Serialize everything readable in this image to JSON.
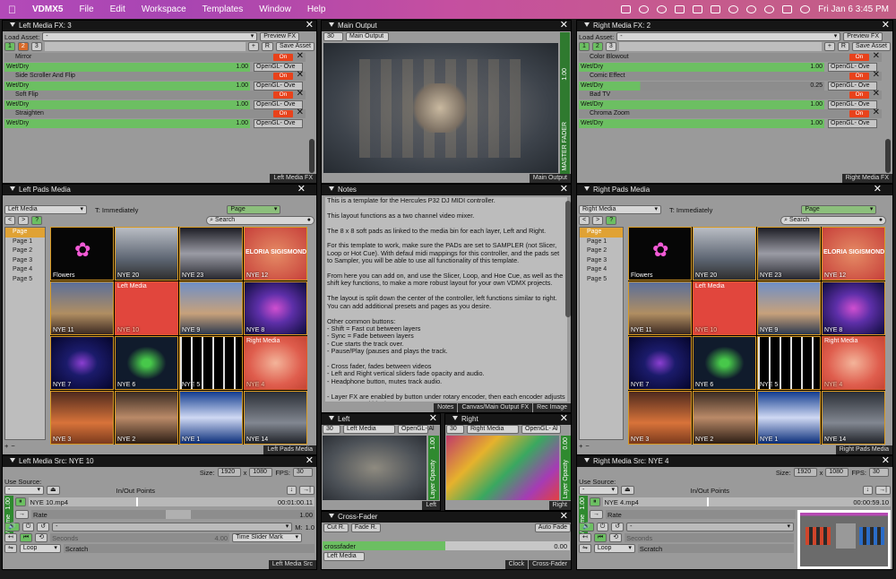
{
  "menubar": {
    "app": "VDMX5",
    "items": [
      "File",
      "Edit",
      "Workspace",
      "Templates",
      "Window",
      "Help"
    ],
    "clock": "Fri Jan 6  3:45 PM"
  },
  "left_fx": {
    "title": "Left Media FX: 3",
    "load_asset": "Load Asset:",
    "preview": "Preview FX",
    "tabs": [
      "1",
      "2",
      "3"
    ],
    "plus": "+",
    "r": "R",
    "save": "Save Asset",
    "effects": [
      {
        "name": "Mirror",
        "on": "On",
        "wd": "Wet/Dry",
        "val": "1.00",
        "gl": "OpenGL- Ove"
      },
      {
        "name": "Side Scroller And Flip",
        "on": "On",
        "wd": "Wet/Dry",
        "val": "1.00",
        "gl": "OpenGL- Ove"
      },
      {
        "name": "Soft Flip",
        "on": "On",
        "wd": "Wet/Dry",
        "val": "1.00",
        "gl": "OpenGL- Ove"
      },
      {
        "name": "Straighten",
        "on": "On",
        "wd": "Wet/Dry",
        "val": "1.00",
        "gl": "OpenGL- Ove"
      }
    ],
    "footer": "Left Media FX"
  },
  "main_output": {
    "title": "Main Output",
    "fps": "30",
    "sel": "Main Output",
    "fader": "MASTER FADER",
    "fader_val": "1.00",
    "footer": "Main Output"
  },
  "right_fx": {
    "title": "Right Media FX: 2",
    "load_asset": "Load Asset:",
    "preview": "Preview FX",
    "tabs": [
      "1",
      "2",
      "3"
    ],
    "plus": "+",
    "r": "R",
    "save": "Save Asset",
    "effects": [
      {
        "name": "Color Blowout",
        "on": "On",
        "wd": "Wet/Dry",
        "val": "1.00",
        "gl": "OpenGL- Ove"
      },
      {
        "name": "Comic Effect",
        "on": "On",
        "wd": "Wet/Dry",
        "val": "0.25",
        "gl": "OpenGL- Ove"
      },
      {
        "name": "Bad TV",
        "on": "On",
        "wd": "Wet/Dry",
        "val": "1.00",
        "gl": "OpenGL- Ove"
      },
      {
        "name": "Chroma Zoom",
        "on": "On",
        "wd": "Wet/Dry",
        "val": "1.00",
        "gl": "OpenGL- Ove"
      }
    ],
    "footer": "Right Media FX"
  },
  "left_pads": {
    "title": "Left Pads Media",
    "media": "Left Media",
    "trigger": "T: Immediately",
    "page": "Page",
    "search": "Search",
    "footer": "Left Pads Media",
    "pages": [
      "Page",
      "Page 1",
      "Page 2",
      "Page 3",
      "Page 4",
      "Page 5"
    ],
    "clips": [
      "Flowers",
      "NYE 20",
      "NYE 23",
      "NYE 12",
      "NYE 11",
      "NYE 10",
      "NYE 9",
      "NYE 8",
      "NYE 7",
      "NYE 6",
      "NYE 5",
      "NYE 4",
      "NYE 3",
      "NYE 2",
      "NYE 1",
      "NYE 14"
    ],
    "logo": "ELORIA SIGISMONDI",
    "tag10": "Left Media",
    "tag8": "Right Media"
  },
  "right_pads": {
    "title": "Right Pads Media",
    "media": "Right Media",
    "trigger": "T: Immediately",
    "page": "Page",
    "search": "Search",
    "footer": "Right Pads Media",
    "pages": [
      "Page",
      "Page 1",
      "Page 2",
      "Page 3",
      "Page 4",
      "Page 5"
    ],
    "clips": [
      "Flowers",
      "NYE 20",
      "NYE 23",
      "NYE 12",
      "NYE 11",
      "NYE 10",
      "NYE 9",
      "NYE 8",
      "NYE 7",
      "NYE 6",
      "NYE 5",
      "NYE 4",
      "NYE 3",
      "NYE 2",
      "NYE 1",
      "NYE 14"
    ],
    "logo": "ELORIA SIGISMONDI",
    "tag10": "Left Media",
    "tag8": "Right Media"
  },
  "notes": {
    "title": "Notes",
    "footer": [
      "Notes",
      "Canvas/Main Output FX",
      "Rec Image"
    ],
    "text": "This is a template for the Hercules P32 DJ MIDI controller.\n\nThis layout functions as a two channel video mixer.\n\nThe 8 x 8 soft pads as linked to the media bin for each layer, Left and Right.\n\nFor this template to work, make sure the PADs are set to SAMPLER (not Slicer, Loop or Hot Cue). With defaul midi mappings for this controller, and the pads set to Sampler, you will be able to use all functionality of this template.\n\nFrom here you can add on, and use the Slicer, Loop, and Hoe Cue, as well as the shift key functions, to make a more robust layout for your own VDMX projects.\n\nThe layout is split down the center of the controller, left functions similar to right.  You can add additional presets and pages as you desire.\n\nOther common buttons:\n- Shift = Fast cut between layers\n- Sync = Fade between layers\n- Cue starts the track over.\n- Pause/Play (pauses and plays the track.\n\n- Cross fader, fades between videos\n- Left and Right vertical sliders fade opacity and audio.\n- Headphone button, mutes track audio.\n\n- Layer FX are enabled by button under rotary encoder, then each encoder adjusts a parameter within that FX\n\n- Top left and right corner of the controller, the Loop/Tempo, Active/Reset"
  },
  "left_prev": {
    "title": "Left",
    "fps": "30",
    "sel": "Left Media",
    "gl": "OpenGL- Al",
    "op": "Layer Opacity",
    "opv": "1.00",
    "footer": "Left"
  },
  "right_prev": {
    "title": "Right",
    "fps": "30",
    "sel": "Right Media",
    "gl": "OpenGL- Al",
    "op": "Layer Opacity",
    "opv": "0.00",
    "footer": "Right"
  },
  "left_src": {
    "title": "Left Media Src: NYE 10",
    "size": "Size:",
    "w": "1920",
    "x": "x",
    "h": "1080",
    "fps": "FPS:",
    "fpsv": "30",
    "use": "Use Source:",
    "inout": "In/Out Points",
    "vol": "Volume",
    "volv": "1.00",
    "file": "NYE 10.mp4",
    "time": "00:01:00.11",
    "rate": "Rate",
    "ratev": "1.00",
    "m": "M:",
    "mv": "1.0",
    "seconds": "Seconds",
    "secv": "4.00",
    "mark": "Time Slider Mark",
    "loop": "Loop",
    "scratch": "Scratch",
    "footer": "Left Media Src"
  },
  "right_src": {
    "title": "Right Media Src: NYE 4",
    "size": "Size:",
    "w": "1920",
    "x": "x",
    "h": "1080",
    "fps": "FPS:",
    "fpsv": "30",
    "use": "Use Source:",
    "inout": "In/Out Points",
    "vol": "Volume",
    "volv": "1.00",
    "file": "NYE 4.mp4",
    "time": "00:00:59.10",
    "rate": "Rate",
    "seconds": "Seconds",
    "loop": "Loop",
    "scratch": "Scratch",
    "footer": "Right Media Src"
  },
  "crossfader": {
    "title": "Cross-Fader",
    "cut": "Cut R.",
    "fade": "Fade R.",
    "auto": "Auto Fade",
    "label": "crossfader",
    "val": "0.00",
    "media": "Left Media",
    "footer": [
      "Clock",
      "Cross-Fader"
    ]
  }
}
